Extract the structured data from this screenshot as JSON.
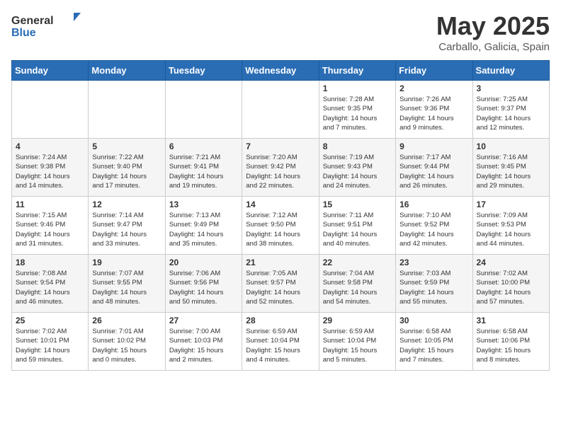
{
  "header": {
    "logo_general": "General",
    "logo_blue": "Blue",
    "title": "May 2025",
    "subtitle": "Carballo, Galicia, Spain"
  },
  "days_of_week": [
    "Sunday",
    "Monday",
    "Tuesday",
    "Wednesday",
    "Thursday",
    "Friday",
    "Saturday"
  ],
  "weeks": [
    [
      {
        "day": "",
        "info": ""
      },
      {
        "day": "",
        "info": ""
      },
      {
        "day": "",
        "info": ""
      },
      {
        "day": "",
        "info": ""
      },
      {
        "day": "1",
        "info": "Sunrise: 7:28 AM\nSunset: 9:35 PM\nDaylight: 14 hours\nand 7 minutes."
      },
      {
        "day": "2",
        "info": "Sunrise: 7:26 AM\nSunset: 9:36 PM\nDaylight: 14 hours\nand 9 minutes."
      },
      {
        "day": "3",
        "info": "Sunrise: 7:25 AM\nSunset: 9:37 PM\nDaylight: 14 hours\nand 12 minutes."
      }
    ],
    [
      {
        "day": "4",
        "info": "Sunrise: 7:24 AM\nSunset: 9:38 PM\nDaylight: 14 hours\nand 14 minutes."
      },
      {
        "day": "5",
        "info": "Sunrise: 7:22 AM\nSunset: 9:40 PM\nDaylight: 14 hours\nand 17 minutes."
      },
      {
        "day": "6",
        "info": "Sunrise: 7:21 AM\nSunset: 9:41 PM\nDaylight: 14 hours\nand 19 minutes."
      },
      {
        "day": "7",
        "info": "Sunrise: 7:20 AM\nSunset: 9:42 PM\nDaylight: 14 hours\nand 22 minutes."
      },
      {
        "day": "8",
        "info": "Sunrise: 7:19 AM\nSunset: 9:43 PM\nDaylight: 14 hours\nand 24 minutes."
      },
      {
        "day": "9",
        "info": "Sunrise: 7:17 AM\nSunset: 9:44 PM\nDaylight: 14 hours\nand 26 minutes."
      },
      {
        "day": "10",
        "info": "Sunrise: 7:16 AM\nSunset: 9:45 PM\nDaylight: 14 hours\nand 29 minutes."
      }
    ],
    [
      {
        "day": "11",
        "info": "Sunrise: 7:15 AM\nSunset: 9:46 PM\nDaylight: 14 hours\nand 31 minutes."
      },
      {
        "day": "12",
        "info": "Sunrise: 7:14 AM\nSunset: 9:47 PM\nDaylight: 14 hours\nand 33 minutes."
      },
      {
        "day": "13",
        "info": "Sunrise: 7:13 AM\nSunset: 9:49 PM\nDaylight: 14 hours\nand 35 minutes."
      },
      {
        "day": "14",
        "info": "Sunrise: 7:12 AM\nSunset: 9:50 PM\nDaylight: 14 hours\nand 38 minutes."
      },
      {
        "day": "15",
        "info": "Sunrise: 7:11 AM\nSunset: 9:51 PM\nDaylight: 14 hours\nand 40 minutes."
      },
      {
        "day": "16",
        "info": "Sunrise: 7:10 AM\nSunset: 9:52 PM\nDaylight: 14 hours\nand 42 minutes."
      },
      {
        "day": "17",
        "info": "Sunrise: 7:09 AM\nSunset: 9:53 PM\nDaylight: 14 hours\nand 44 minutes."
      }
    ],
    [
      {
        "day": "18",
        "info": "Sunrise: 7:08 AM\nSunset: 9:54 PM\nDaylight: 14 hours\nand 46 minutes."
      },
      {
        "day": "19",
        "info": "Sunrise: 7:07 AM\nSunset: 9:55 PM\nDaylight: 14 hours\nand 48 minutes."
      },
      {
        "day": "20",
        "info": "Sunrise: 7:06 AM\nSunset: 9:56 PM\nDaylight: 14 hours\nand 50 minutes."
      },
      {
        "day": "21",
        "info": "Sunrise: 7:05 AM\nSunset: 9:57 PM\nDaylight: 14 hours\nand 52 minutes."
      },
      {
        "day": "22",
        "info": "Sunrise: 7:04 AM\nSunset: 9:58 PM\nDaylight: 14 hours\nand 54 minutes."
      },
      {
        "day": "23",
        "info": "Sunrise: 7:03 AM\nSunset: 9:59 PM\nDaylight: 14 hours\nand 55 minutes."
      },
      {
        "day": "24",
        "info": "Sunrise: 7:02 AM\nSunset: 10:00 PM\nDaylight: 14 hours\nand 57 minutes."
      }
    ],
    [
      {
        "day": "25",
        "info": "Sunrise: 7:02 AM\nSunset: 10:01 PM\nDaylight: 14 hours\nand 59 minutes."
      },
      {
        "day": "26",
        "info": "Sunrise: 7:01 AM\nSunset: 10:02 PM\nDaylight: 15 hours\nand 0 minutes."
      },
      {
        "day": "27",
        "info": "Sunrise: 7:00 AM\nSunset: 10:03 PM\nDaylight: 15 hours\nand 2 minutes."
      },
      {
        "day": "28",
        "info": "Sunrise: 6:59 AM\nSunset: 10:04 PM\nDaylight: 15 hours\nand 4 minutes."
      },
      {
        "day": "29",
        "info": "Sunrise: 6:59 AM\nSunset: 10:04 PM\nDaylight: 15 hours\nand 5 minutes."
      },
      {
        "day": "30",
        "info": "Sunrise: 6:58 AM\nSunset: 10:05 PM\nDaylight: 15 hours\nand 7 minutes."
      },
      {
        "day": "31",
        "info": "Sunrise: 6:58 AM\nSunset: 10:06 PM\nDaylight: 15 hours\nand 8 minutes."
      }
    ]
  ]
}
